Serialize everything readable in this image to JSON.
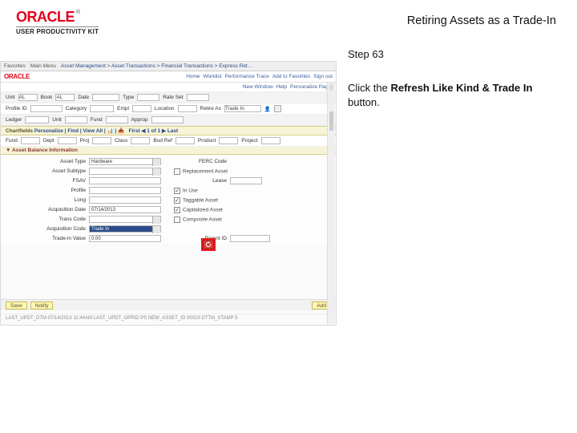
{
  "header": {
    "logo_text": "ORACLE",
    "logo_tm": "®",
    "upk_text": "USER PRODUCTIVITY KIT",
    "page_title": "Retiring Assets as a Trade-In"
  },
  "instruction": {
    "step_label": "Step 63",
    "prefix": "Click the ",
    "bold": "Refresh Like Kind & Trade In",
    "suffix": " button."
  },
  "app": {
    "tabs": {
      "t1": "Favorites",
      "t2": "Main Menu",
      "crumb": "Asset Management > Asset Transactions > Financial Transactions > Express Ret…"
    },
    "topright": {
      "l1": "Home",
      "l2": "Worklist",
      "l3": "Performance Trace",
      "l4": "Add to Favorites",
      "l5": "Sign out"
    },
    "mini_links": {
      "a": "New Window",
      "b": "Help",
      "c": "Personalize Page"
    },
    "row_unit": {
      "unit_l": "Unit",
      "unit_v": "AL",
      "book_l": "Book",
      "book_v": "AL",
      "date_l": "Date",
      "date_v": "",
      "type_l": "Type",
      "type_v": "",
      "rateset_l": "Rate Set",
      "rateset_v": ""
    },
    "row_prof": {
      "profile_l": "Profile ID",
      "cat_l": "Category",
      "emp_l": "Empl",
      "loc_l": "Location",
      "retire_l": "Retire As",
      "retire_v": "Trade In"
    },
    "row_ledger": {
      "ledger_l": "Ledger",
      "unit_l": "Unit",
      "fund_l": "Fund",
      "appr_l": "Approp"
    },
    "chartfields_l": "Chartfields",
    "pager": {
      "pers": "Personalize",
      "find": "Find | View All",
      "count": "First ◀ 1 of 1 ▶ Last"
    },
    "cf_cols": {
      "c1": "Fund",
      "c2": "Dept",
      "c3": "Proj",
      "c4": "Class",
      "c5": "Bud Ref",
      "c6": "Product",
      "c7": "Project"
    },
    "asset_bal_l": "▼ Asset Balance Information",
    "detail": {
      "asset_type_l": "Asset Type",
      "asset_type_v": "Hardware",
      "asset_subtype_l": "Asset Subtype",
      "fsav_l": "FSAV",
      "ferc_l": "FERC Code",
      "lease_l": "Lease",
      "long_l": "Long",
      "replace_l": "Replacement Asset",
      "profile_l": "Profile",
      "in_service_l": "In Use",
      "tagable_l": "Taggable Asset",
      "capitalized_l": "Capitalized Asset",
      "composite_l": "Composite Asset",
      "acq_date_l": "Acquisition Date",
      "acq_date_v": "07/14/2013",
      "trans_code_l": "Trans Code",
      "acq_code_l": "Acquisition Code",
      "acq_code_v": "Trade In",
      "trade_in_l": "Trade-in Value",
      "trade_in_v": "0.00",
      "parent_l": "Parent ID"
    },
    "footer": {
      "save": "Save",
      "notify": "Notify",
      "add": "Add"
    },
    "audit": "LAST_UPDT_DTM  07/14/2013 11:44AM   LAST_UPDT_OPRID  PS    NEW_ASSET_ID  00019    DTTM_STAMP  5   "
  }
}
